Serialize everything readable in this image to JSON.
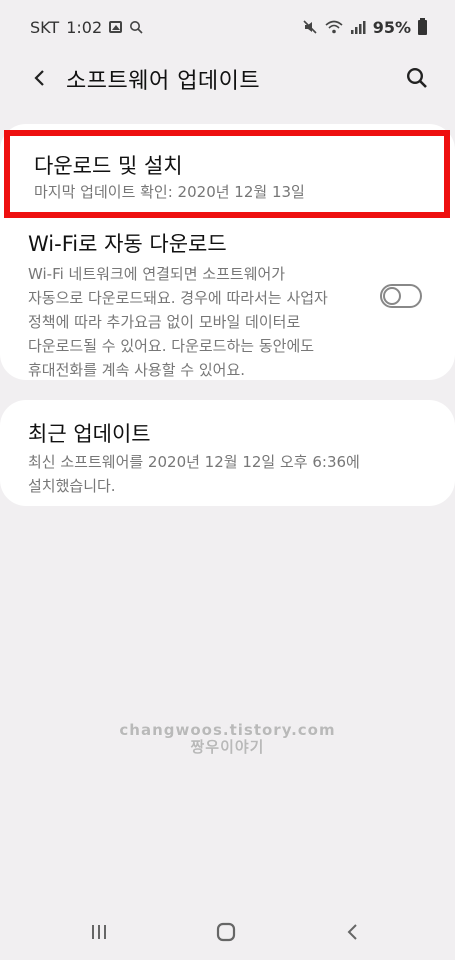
{
  "status_bar": {
    "carrier": "SKT",
    "time": "1:02",
    "battery": "95%",
    "icons": [
      "image-icon",
      "search-icon",
      "mute-icon",
      "wifi-icon",
      "signal-icon",
      "battery-icon"
    ]
  },
  "header": {
    "title": "소프트웨어 업데이트",
    "back_icon": "back-arrow-icon",
    "search_icon": "search-icon"
  },
  "items": {
    "download": {
      "title": "다운로드 및 설치",
      "subtitle": "마지막 업데이트 확인: 2020년 12월 13일"
    },
    "wifi_auto": {
      "title": "Wi-Fi로 자동 다운로드",
      "description": "Wi-Fi 네트워크에 연결되면 소프트웨어가\n자동으로 다운로드돼요. 경우에 따라서는 사업자\n정책에 따라 추가요금 없이 모바일 데이터로\n다운로드될 수 있어요. 다운로드하는 동안에도\n휴대전화를 계속 사용할 수 있어요.",
      "toggle_on": false
    },
    "recent": {
      "title": "최근 업데이트",
      "description": "최신 소프트웨어를 2020년 12월 12일 오후 6:36에\n설치했습니다."
    }
  },
  "watermark": {
    "line1": "changwoos.tistory.com",
    "line2": "짱우이야기"
  },
  "colors": {
    "background": "#f1eff1",
    "card": "#ffffff",
    "highlight_border": "#ee1010"
  },
  "nav_bar": {
    "icons": [
      "recent-apps-icon",
      "home-icon",
      "back-icon"
    ]
  }
}
